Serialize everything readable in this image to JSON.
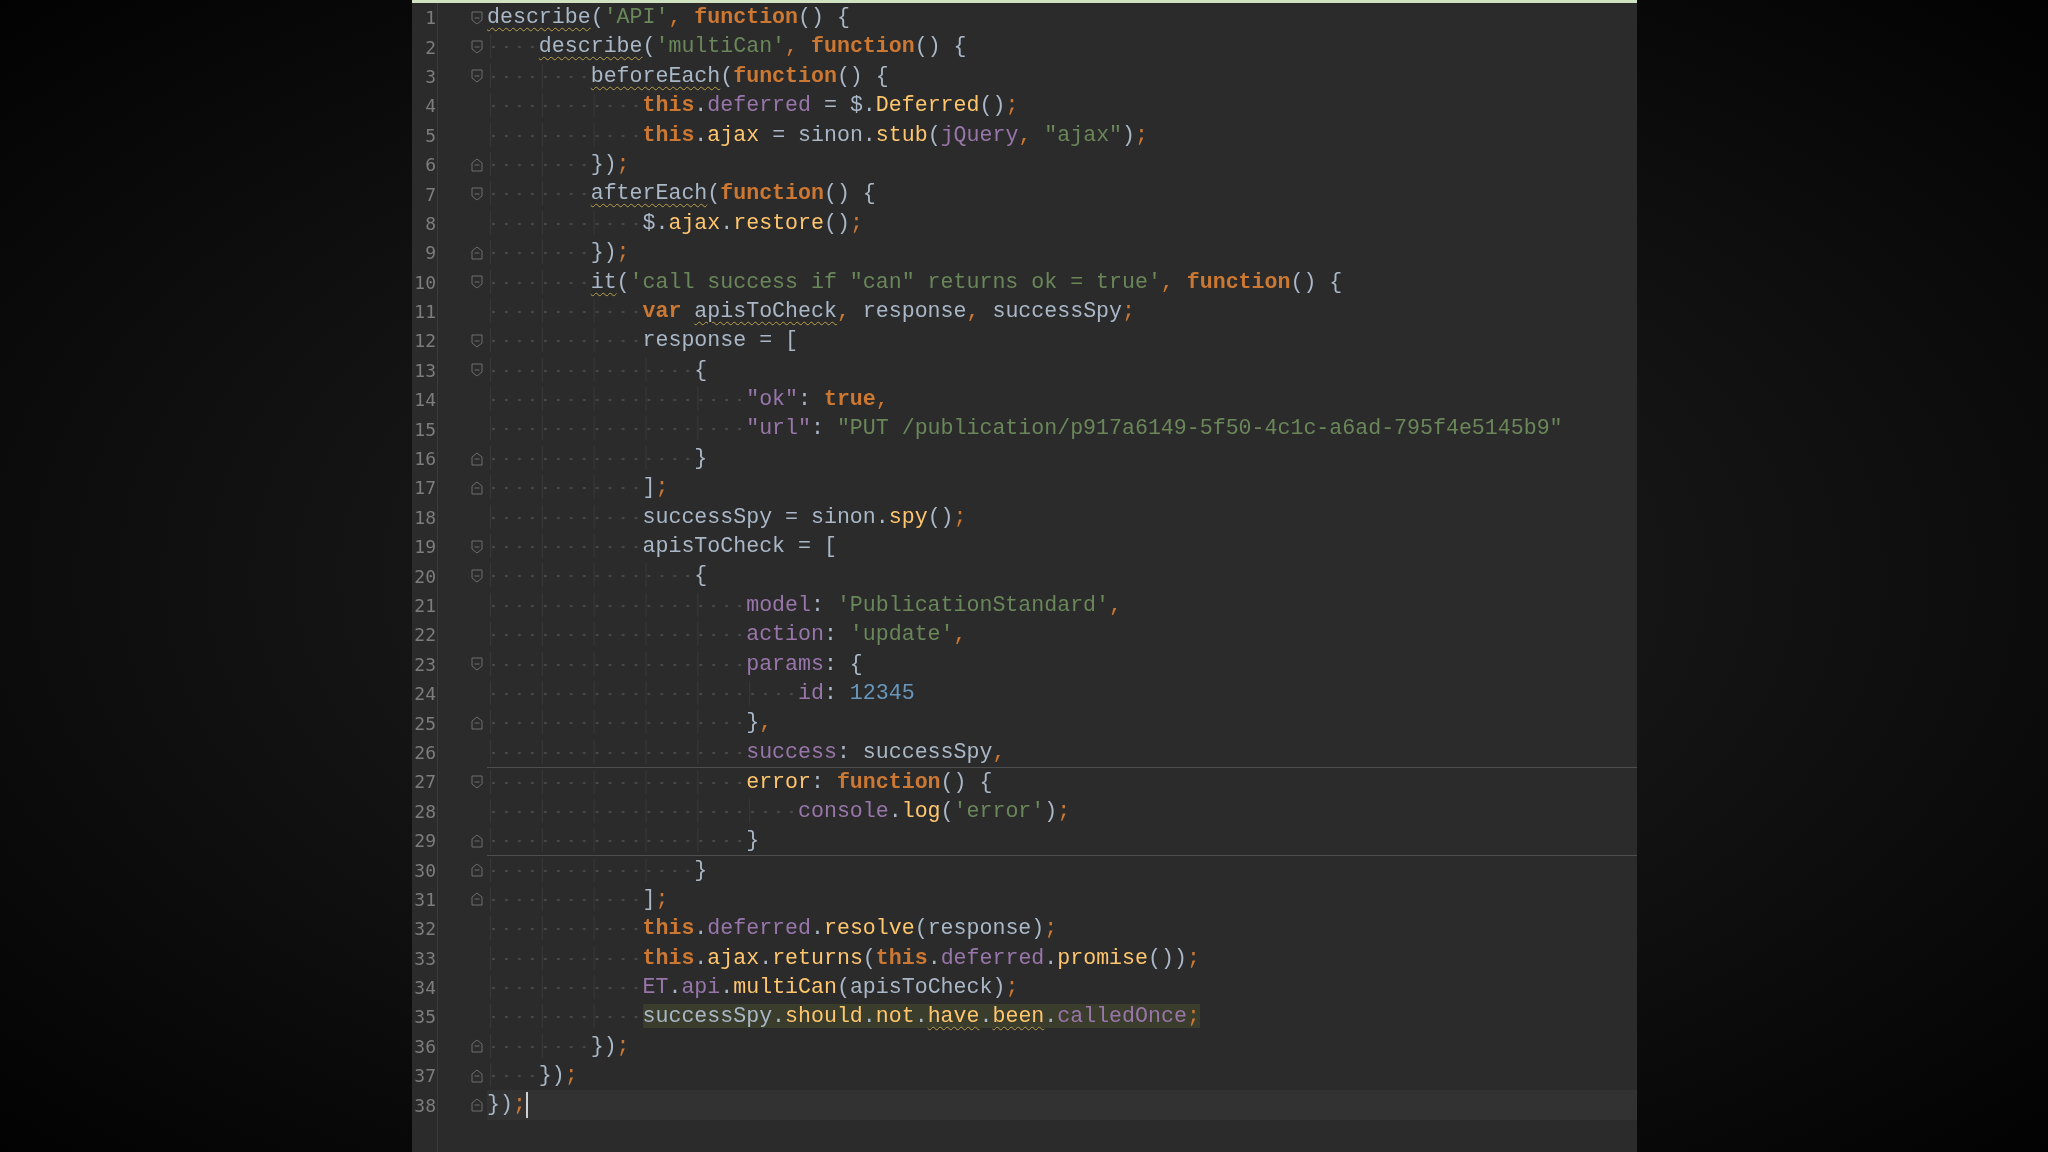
{
  "lines": [
    {
      "number": "1",
      "fold_start": true,
      "fold_end": false,
      "divider_above": false,
      "highlighted": false,
      "current": false,
      "tokens": [
        {
          "text": "describe",
          "kind": "plain",
          "underlined": true
        },
        {
          "text": "(",
          "kind": "plain",
          "underlined": false
        },
        {
          "text": "'API'",
          "kind": "string",
          "underlined": false
        },
        {
          "text": ", ",
          "kind": "punctuation",
          "underlined": false
        },
        {
          "text": "function",
          "kind": "keyword",
          "underlined": false
        },
        {
          "text": "() {",
          "kind": "plain",
          "underlined": false
        }
      ]
    },
    {
      "number": "2",
      "fold_start": true,
      "fold_end": false,
      "divider_above": false,
      "highlighted": false,
      "current": false,
      "tokens": [
        {
          "text": "    describe",
          "kind": "plain",
          "underlined": true
        },
        {
          "text": "(",
          "kind": "plain",
          "underlined": false
        },
        {
          "text": "'multiCan'",
          "kind": "string",
          "underlined": false
        },
        {
          "text": ", ",
          "kind": "punctuation",
          "underlined": false
        },
        {
          "text": "function",
          "kind": "keyword",
          "underlined": false
        },
        {
          "text": "() {",
          "kind": "plain",
          "underlined": false
        }
      ]
    },
    {
      "number": "3",
      "fold_start": true,
      "fold_end": false,
      "divider_above": false,
      "highlighted": false,
      "current": false,
      "tokens": [
        {
          "text": "        beforeEach",
          "kind": "plain",
          "underlined": true
        },
        {
          "text": "(",
          "kind": "plain",
          "underlined": false
        },
        {
          "text": "function",
          "kind": "keyword",
          "underlined": false
        },
        {
          "text": "() {",
          "kind": "plain",
          "underlined": false
        }
      ]
    },
    {
      "number": "4",
      "fold_start": false,
      "fold_end": false,
      "divider_above": false,
      "highlighted": false,
      "current": false,
      "tokens": [
        {
          "text": "            this",
          "kind": "keyword",
          "underlined": false
        },
        {
          "text": ".",
          "kind": "plain",
          "underlined": false
        },
        {
          "text": "deferred",
          "kind": "property",
          "underlined": false
        },
        {
          "text": " = $.",
          "kind": "plain",
          "underlined": false
        },
        {
          "text": "Deferred",
          "kind": "method",
          "underlined": false
        },
        {
          "text": "()",
          "kind": "plain",
          "underlined": false
        },
        {
          "text": ";",
          "kind": "punctuation",
          "underlined": false
        }
      ]
    },
    {
      "number": "5",
      "fold_start": false,
      "fold_end": false,
      "divider_above": false,
      "highlighted": false,
      "current": false,
      "tokens": [
        {
          "text": "            this",
          "kind": "keyword",
          "underlined": false
        },
        {
          "text": ".",
          "kind": "plain",
          "underlined": false
        },
        {
          "text": "ajax",
          "kind": "method",
          "underlined": false
        },
        {
          "text": " = sinon.",
          "kind": "plain",
          "underlined": false
        },
        {
          "text": "stub",
          "kind": "method",
          "underlined": false
        },
        {
          "text": "(",
          "kind": "plain",
          "underlined": false
        },
        {
          "text": "jQuery",
          "kind": "property",
          "underlined": false
        },
        {
          "text": ", ",
          "kind": "punctuation",
          "underlined": false
        },
        {
          "text": "\"ajax\"",
          "kind": "string",
          "underlined": false
        },
        {
          "text": ")",
          "kind": "plain",
          "underlined": false
        },
        {
          "text": ";",
          "kind": "punctuation",
          "underlined": false
        }
      ]
    },
    {
      "number": "6",
      "fold_start": false,
      "fold_end": true,
      "divider_above": false,
      "highlighted": false,
      "current": false,
      "tokens": [
        {
          "text": "        })",
          "kind": "plain",
          "underlined": false
        },
        {
          "text": ";",
          "kind": "punctuation",
          "underlined": false
        }
      ]
    },
    {
      "number": "7",
      "fold_start": true,
      "fold_end": false,
      "divider_above": false,
      "highlighted": false,
      "current": false,
      "tokens": [
        {
          "text": "        afterEach",
          "kind": "plain",
          "underlined": true
        },
        {
          "text": "(",
          "kind": "plain",
          "underlined": false
        },
        {
          "text": "function",
          "kind": "keyword",
          "underlined": false
        },
        {
          "text": "() {",
          "kind": "plain",
          "underlined": false
        }
      ]
    },
    {
      "number": "8",
      "fold_start": false,
      "fold_end": false,
      "divider_above": false,
      "highlighted": false,
      "current": false,
      "tokens": [
        {
          "text": "            $.",
          "kind": "plain",
          "underlined": false
        },
        {
          "text": "ajax",
          "kind": "method",
          "underlined": false
        },
        {
          "text": ".",
          "kind": "plain",
          "underlined": false
        },
        {
          "text": "restore",
          "kind": "method",
          "underlined": false
        },
        {
          "text": "()",
          "kind": "plain",
          "underlined": false
        },
        {
          "text": ";",
          "kind": "punctuation",
          "underlined": false
        }
      ]
    },
    {
      "number": "9",
      "fold_start": false,
      "fold_end": true,
      "divider_above": false,
      "highlighted": false,
      "current": false,
      "tokens": [
        {
          "text": "        })",
          "kind": "plain",
          "underlined": false
        },
        {
          "text": ";",
          "kind": "punctuation",
          "underlined": false
        }
      ]
    },
    {
      "number": "10",
      "fold_start": true,
      "fold_end": false,
      "divider_above": false,
      "highlighted": false,
      "current": false,
      "tokens": [
        {
          "text": "        it",
          "kind": "plain",
          "underlined": true
        },
        {
          "text": "(",
          "kind": "plain",
          "underlined": false
        },
        {
          "text": "'call success if \"can\" returns ok = true'",
          "kind": "string",
          "underlined": false
        },
        {
          "text": ", ",
          "kind": "punctuation",
          "underlined": false
        },
        {
          "text": "function",
          "kind": "keyword",
          "underlined": false
        },
        {
          "text": "() {",
          "kind": "plain",
          "underlined": false
        }
      ]
    },
    {
      "number": "11",
      "fold_start": false,
      "fold_end": false,
      "divider_above": false,
      "highlighted": false,
      "current": false,
      "tokens": [
        {
          "text": "            var ",
          "kind": "keyword",
          "underlined": false
        },
        {
          "text": "apisToCheck",
          "kind": "plain",
          "underlined": true
        },
        {
          "text": ", ",
          "kind": "punctuation",
          "underlined": false
        },
        {
          "text": "response",
          "kind": "plain",
          "underlined": false
        },
        {
          "text": ", ",
          "kind": "punctuation",
          "underlined": false
        },
        {
          "text": "successSpy",
          "kind": "plain",
          "underlined": false
        },
        {
          "text": ";",
          "kind": "punctuation",
          "underlined": false
        }
      ]
    },
    {
      "number": "12",
      "fold_start": true,
      "fold_end": false,
      "divider_above": false,
      "highlighted": false,
      "current": false,
      "tokens": [
        {
          "text": "            response = [",
          "kind": "plain",
          "underlined": false
        }
      ]
    },
    {
      "number": "13",
      "fold_start": true,
      "fold_end": false,
      "divider_above": false,
      "highlighted": false,
      "current": false,
      "tokens": [
        {
          "text": "                {",
          "kind": "plain",
          "underlined": false
        }
      ]
    },
    {
      "number": "14",
      "fold_start": false,
      "fold_end": false,
      "divider_above": false,
      "highlighted": false,
      "current": false,
      "tokens": [
        {
          "text": "                    \"ok\"",
          "kind": "property",
          "underlined": false
        },
        {
          "text": ": ",
          "kind": "plain",
          "underlined": false
        },
        {
          "text": "true",
          "kind": "keyword",
          "underlined": false
        },
        {
          "text": ",",
          "kind": "punctuation",
          "underlined": false
        }
      ]
    },
    {
      "number": "15",
      "fold_start": false,
      "fold_end": false,
      "divider_above": false,
      "highlighted": false,
      "current": false,
      "tokens": [
        {
          "text": "                    \"url\"",
          "kind": "property",
          "underlined": false
        },
        {
          "text": ": ",
          "kind": "plain",
          "underlined": false
        },
        {
          "text": "\"PUT /publication/p917a6149-5f50-4c1c-a6ad-795f4e5145b9\"",
          "kind": "string",
          "underlined": false
        }
      ]
    },
    {
      "number": "16",
      "fold_start": false,
      "fold_end": true,
      "divider_above": false,
      "highlighted": false,
      "current": false,
      "tokens": [
        {
          "text": "                }",
          "kind": "plain",
          "underlined": false
        }
      ]
    },
    {
      "number": "17",
      "fold_start": false,
      "fold_end": true,
      "divider_above": false,
      "highlighted": false,
      "current": false,
      "tokens": [
        {
          "text": "            ]",
          "kind": "plain",
          "underlined": false
        },
        {
          "text": ";",
          "kind": "punctuation",
          "underlined": false
        }
      ]
    },
    {
      "number": "18",
      "fold_start": false,
      "fold_end": false,
      "divider_above": false,
      "highlighted": false,
      "current": false,
      "tokens": [
        {
          "text": "            successSpy = sinon.",
          "kind": "plain",
          "underlined": false
        },
        {
          "text": "spy",
          "kind": "method",
          "underlined": false
        },
        {
          "text": "()",
          "kind": "plain",
          "underlined": false
        },
        {
          "text": ";",
          "kind": "punctuation",
          "underlined": false
        }
      ]
    },
    {
      "number": "19",
      "fold_start": true,
      "fold_end": false,
      "divider_above": false,
      "highlighted": false,
      "current": false,
      "tokens": [
        {
          "text": "            apisToCheck = [",
          "kind": "plain",
          "underlined": false
        }
      ]
    },
    {
      "number": "20",
      "fold_start": true,
      "fold_end": false,
      "divider_above": false,
      "highlighted": false,
      "current": false,
      "tokens": [
        {
          "text": "                {",
          "kind": "plain",
          "underlined": false
        }
      ]
    },
    {
      "number": "21",
      "fold_start": false,
      "fold_end": false,
      "divider_above": false,
      "highlighted": false,
      "current": false,
      "tokens": [
        {
          "text": "                    model",
          "kind": "property",
          "underlined": false
        },
        {
          "text": ": ",
          "kind": "plain",
          "underlined": false
        },
        {
          "text": "'PublicationStandard'",
          "kind": "string",
          "underlined": false
        },
        {
          "text": ",",
          "kind": "punctuation",
          "underlined": false
        }
      ]
    },
    {
      "number": "22",
      "fold_start": false,
      "fold_end": false,
      "divider_above": false,
      "highlighted": false,
      "current": false,
      "tokens": [
        {
          "text": "                    action",
          "kind": "property",
          "underlined": false
        },
        {
          "text": ": ",
          "kind": "plain",
          "underlined": false
        },
        {
          "text": "'update'",
          "kind": "string",
          "underlined": false
        },
        {
          "text": ",",
          "kind": "punctuation",
          "underlined": false
        }
      ]
    },
    {
      "number": "23",
      "fold_start": true,
      "fold_end": false,
      "divider_above": false,
      "highlighted": false,
      "current": false,
      "tokens": [
        {
          "text": "                    params",
          "kind": "property",
          "underlined": false
        },
        {
          "text": ": {",
          "kind": "plain",
          "underlined": false
        }
      ]
    },
    {
      "number": "24",
      "fold_start": false,
      "fold_end": false,
      "divider_above": false,
      "highlighted": false,
      "current": false,
      "tokens": [
        {
          "text": "                        id",
          "kind": "property",
          "underlined": false
        },
        {
          "text": ": ",
          "kind": "plain",
          "underlined": false
        },
        {
          "text": "12345",
          "kind": "number",
          "underlined": false
        }
      ]
    },
    {
      "number": "25",
      "fold_start": false,
      "fold_end": true,
      "divider_above": false,
      "highlighted": false,
      "current": false,
      "tokens": [
        {
          "text": "                    }",
          "kind": "plain",
          "underlined": false
        },
        {
          "text": ",",
          "kind": "punctuation",
          "underlined": false
        }
      ]
    },
    {
      "number": "26",
      "fold_start": false,
      "fold_end": false,
      "divider_above": false,
      "highlighted": false,
      "current": false,
      "tokens": [
        {
          "text": "                    success",
          "kind": "property",
          "underlined": false
        },
        {
          "text": ": successSpy",
          "kind": "plain",
          "underlined": false
        },
        {
          "text": ",",
          "kind": "punctuation",
          "underlined": false
        }
      ]
    },
    {
      "number": "27",
      "fold_start": true,
      "fold_end": false,
      "divider_above": true,
      "highlighted": false,
      "current": false,
      "tokens": [
        {
          "text": "                    error",
          "kind": "method",
          "underlined": false
        },
        {
          "text": ": ",
          "kind": "plain",
          "underlined": false
        },
        {
          "text": "function",
          "kind": "keyword",
          "underlined": false
        },
        {
          "text": "() {",
          "kind": "plain",
          "underlined": false
        }
      ]
    },
    {
      "number": "28",
      "fold_start": false,
      "fold_end": false,
      "divider_above": false,
      "highlighted": false,
      "current": false,
      "tokens": [
        {
          "text": "                        console",
          "kind": "property",
          "underlined": false
        },
        {
          "text": ".",
          "kind": "plain",
          "underlined": false
        },
        {
          "text": "log",
          "kind": "method",
          "underlined": false
        },
        {
          "text": "(",
          "kind": "plain",
          "underlined": false
        },
        {
          "text": "'error'",
          "kind": "string",
          "underlined": false
        },
        {
          "text": ")",
          "kind": "plain",
          "underlined": false
        },
        {
          "text": ";",
          "kind": "punctuation",
          "underlined": false
        }
      ]
    },
    {
      "number": "29",
      "fold_start": false,
      "fold_end": true,
      "divider_above": false,
      "highlighted": false,
      "current": false,
      "tokens": [
        {
          "text": "                    }",
          "kind": "plain",
          "underlined": false
        }
      ]
    },
    {
      "number": "30",
      "fold_start": false,
      "fold_end": true,
      "divider_above": true,
      "highlighted": false,
      "current": false,
      "tokens": [
        {
          "text": "                }",
          "kind": "plain",
          "underlined": false
        }
      ]
    },
    {
      "number": "31",
      "fold_start": false,
      "fold_end": true,
      "divider_above": false,
      "highlighted": false,
      "current": false,
      "tokens": [
        {
          "text": "            ]",
          "kind": "plain",
          "underlined": false
        },
        {
          "text": ";",
          "kind": "punctuation",
          "underlined": false
        }
      ]
    },
    {
      "number": "32",
      "fold_start": false,
      "fold_end": false,
      "divider_above": false,
      "highlighted": false,
      "current": false,
      "tokens": [
        {
          "text": "            this",
          "kind": "keyword",
          "underlined": false
        },
        {
          "text": ".",
          "kind": "plain",
          "underlined": false
        },
        {
          "text": "deferred",
          "kind": "property",
          "underlined": false
        },
        {
          "text": ".",
          "kind": "plain",
          "underlined": false
        },
        {
          "text": "resolve",
          "kind": "method",
          "underlined": false
        },
        {
          "text": "(response)",
          "kind": "plain",
          "underlined": false
        },
        {
          "text": ";",
          "kind": "punctuation",
          "underlined": false
        }
      ]
    },
    {
      "number": "33",
      "fold_start": false,
      "fold_end": false,
      "divider_above": false,
      "highlighted": false,
      "current": false,
      "tokens": [
        {
          "text": "            this",
          "kind": "keyword",
          "underlined": false
        },
        {
          "text": ".",
          "kind": "plain",
          "underlined": false
        },
        {
          "text": "ajax",
          "kind": "method",
          "underlined": false
        },
        {
          "text": ".",
          "kind": "plain",
          "underlined": false
        },
        {
          "text": "returns",
          "kind": "method",
          "underlined": false
        },
        {
          "text": "(",
          "kind": "plain",
          "underlined": false
        },
        {
          "text": "this",
          "kind": "keyword",
          "underlined": false
        },
        {
          "text": ".",
          "kind": "plain",
          "underlined": false
        },
        {
          "text": "deferred",
          "kind": "property",
          "underlined": false
        },
        {
          "text": ".",
          "kind": "plain",
          "underlined": false
        },
        {
          "text": "promise",
          "kind": "method",
          "underlined": false
        },
        {
          "text": "())",
          "kind": "plain",
          "underlined": false
        },
        {
          "text": ";",
          "kind": "punctuation",
          "underlined": false
        }
      ]
    },
    {
      "number": "34",
      "fold_start": false,
      "fold_end": false,
      "divider_above": false,
      "highlighted": false,
      "current": false,
      "tokens": [
        {
          "text": "            ET",
          "kind": "property",
          "underlined": false
        },
        {
          "text": ".",
          "kind": "plain",
          "underlined": false
        },
        {
          "text": "api",
          "kind": "property",
          "underlined": false
        },
        {
          "text": ".",
          "kind": "plain",
          "underlined": false
        },
        {
          "text": "multiCan",
          "kind": "method",
          "underlined": false
        },
        {
          "text": "(apisToCheck)",
          "kind": "plain",
          "underlined": false
        },
        {
          "text": ";",
          "kind": "punctuation",
          "underlined": false
        }
      ]
    },
    {
      "number": "35",
      "fold_start": false,
      "fold_end": false,
      "divider_above": false,
      "highlighted": true,
      "current": false,
      "tokens": [
        {
          "text": "            successSpy.",
          "kind": "plain",
          "underlined": false
        },
        {
          "text": "should",
          "kind": "method",
          "underlined": false
        },
        {
          "text": ".",
          "kind": "plain",
          "underlined": false
        },
        {
          "text": "not",
          "kind": "method",
          "underlined": false
        },
        {
          "text": ".",
          "kind": "plain",
          "underlined": false
        },
        {
          "text": "have",
          "kind": "method",
          "underlined": true
        },
        {
          "text": ".",
          "kind": "plain",
          "underlined": false
        },
        {
          "text": "been",
          "kind": "method",
          "underlined": true
        },
        {
          "text": ".",
          "kind": "plain",
          "underlined": false
        },
        {
          "text": "calledOnce",
          "kind": "property",
          "underlined": false
        },
        {
          "text": ";",
          "kind": "punctuation",
          "underlined": false
        }
      ]
    },
    {
      "number": "36",
      "fold_start": false,
      "fold_end": true,
      "divider_above": false,
      "highlighted": false,
      "current": false,
      "tokens": [
        {
          "text": "        })",
          "kind": "plain",
          "underlined": false
        },
        {
          "text": ";",
          "kind": "punctuation",
          "underlined": false
        }
      ]
    },
    {
      "number": "37",
      "fold_start": false,
      "fold_end": true,
      "divider_above": false,
      "highlighted": false,
      "current": false,
      "tokens": [
        {
          "text": "    })",
          "kind": "plain",
          "underlined": false
        },
        {
          "text": ";",
          "kind": "punctuation",
          "underlined": false
        }
      ]
    },
    {
      "number": "38",
      "fold_start": false,
      "fold_end": true,
      "divider_above": false,
      "highlighted": false,
      "current": true,
      "tokens": [
        {
          "text": "})",
          "kind": "plain",
          "underlined": false
        },
        {
          "text": ";",
          "kind": "punctuation",
          "underlined": false
        }
      ]
    }
  ]
}
